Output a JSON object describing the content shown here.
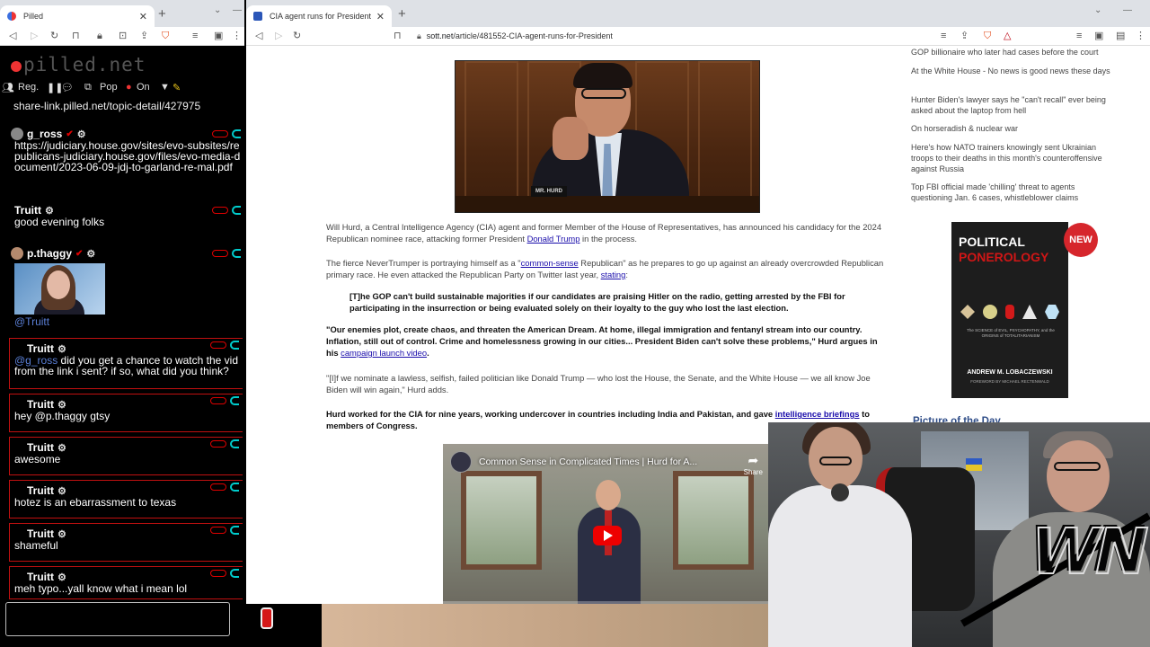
{
  "left_browser": {
    "tab_title": "Pilled",
    "chat": {
      "logo": "pilled.net",
      "nav": [
        "Reg.",
        "Pop",
        "On"
      ],
      "topic_link": "share-link.pilled.net/topic-detail/427975",
      "messages": [
        {
          "user": "g_ross",
          "body": "https://judiciary.house.gov/sites/evo-subsites/republicans-judiciary.house.gov/files/evo-media-document/2023-06-09-jdj-to-garland-re-mal.pdf"
        },
        {
          "user": "Truitt",
          "body": "good evening folks"
        },
        {
          "user": "p.thaggy",
          "body": "@Truitt"
        },
        {
          "user": "Truitt",
          "mention": "@g_ross",
          "body": " did you get a chance to watch the vid from the link i sent? if so, what did you think?"
        },
        {
          "user": "Truitt",
          "mention": "hey @p.thaggy",
          "body": " gtsy"
        },
        {
          "user": "Truitt",
          "body": "awesome"
        },
        {
          "user": "Truitt",
          "body": "hotez is an ebarrassment to texas"
        },
        {
          "user": "Truitt",
          "body": "shameful"
        },
        {
          "user": "Truitt",
          "body": "meh typo...yall know what i mean lol"
        }
      ]
    }
  },
  "right_browser": {
    "tab_title": "CIA agent runs for President -- P...",
    "url_domain": "sott.net",
    "url_path": "/article/481552-CIA-agent-runs-for-President",
    "article": {
      "hero_nameplate": "MR. HURD",
      "p1": {
        "before": "Will Hurd, a Central Intelligence Agency (CIA) agent and former Member of the House of Representatives, has announced his candidacy for the 2024 Republican nominee race, attacking former President ",
        "link": "Donald Trump",
        "after": " in the process."
      },
      "p2": {
        "before": "The fierce NeverTrumper is portraying himself as a \"",
        "link1": "common-sense",
        "mid": " Republican\" as he prepares to go up against an already overcrowded Republican primary race. He even attacked the Republican Party on Twitter last year, ",
        "link2": "stating",
        "after": ":"
      },
      "quote": "[T]he GOP can't build sustainable majorities if our candidates are praising Hitler on the radio, getting arrested by the FBI for participating in the insurrection or being evaluated solely on their loyalty to the guy who lost the last election.",
      "p3": {
        "before": "\"Our enemies plot, create chaos, and threaten the American Dream. At home, illegal immigration and fentanyl stream into our country. Inflation, still out of control. Crime and homelessness growing in our cities... President Biden can't solve these problems,\" Hurd argues in his ",
        "link": "campaign launch video",
        "after": "."
      },
      "p4": "\"[I]f we nominate a lawless, selfish, failed politician like Donald Trump — who lost the House, the Senate, and the White House — we all know Joe Biden will win again,\" Hurd adds.",
      "p5": {
        "before": "Hurd worked for the CIA for nine years, working undercover in countries including India and Pakistan, and gave ",
        "link": "intelligence briefings",
        "after": " to members of Congress."
      },
      "video": {
        "title": "Common Sense in Complicated Times | Hurd for A...",
        "share_label": "Share"
      }
    },
    "sidebar": {
      "links": [
        "GOP billionaire who later had cases before the court",
        "At the White House - No news is good news these days",
        "Hunter Biden's lawyer says he \"can't recall\" ever being asked about the laptop from hell",
        "On horseradish & nuclear war",
        "Here's how NATO trainers knowingly sent Ukrainian troops to their deaths in this month's counteroffensive against Russia",
        "Top FBI official made 'chilling' threat to agents questioning Jan. 6 cases, whistleblower claims"
      ],
      "book": {
        "title_line1": "POLITICAL",
        "title_line2": "PONEROLOGY",
        "subtitle": "The SCIENCE of EVIL, PSYCHOPATHY, and the ORIGINS of TOTALITARIANISM",
        "author": "ANDREW M. LOBACZEWSKI",
        "foreword": "FOREWORD BY MICHAEL RECTENWALD",
        "badge": "NEW"
      },
      "picture_of_day": "Picture of the Day"
    }
  }
}
